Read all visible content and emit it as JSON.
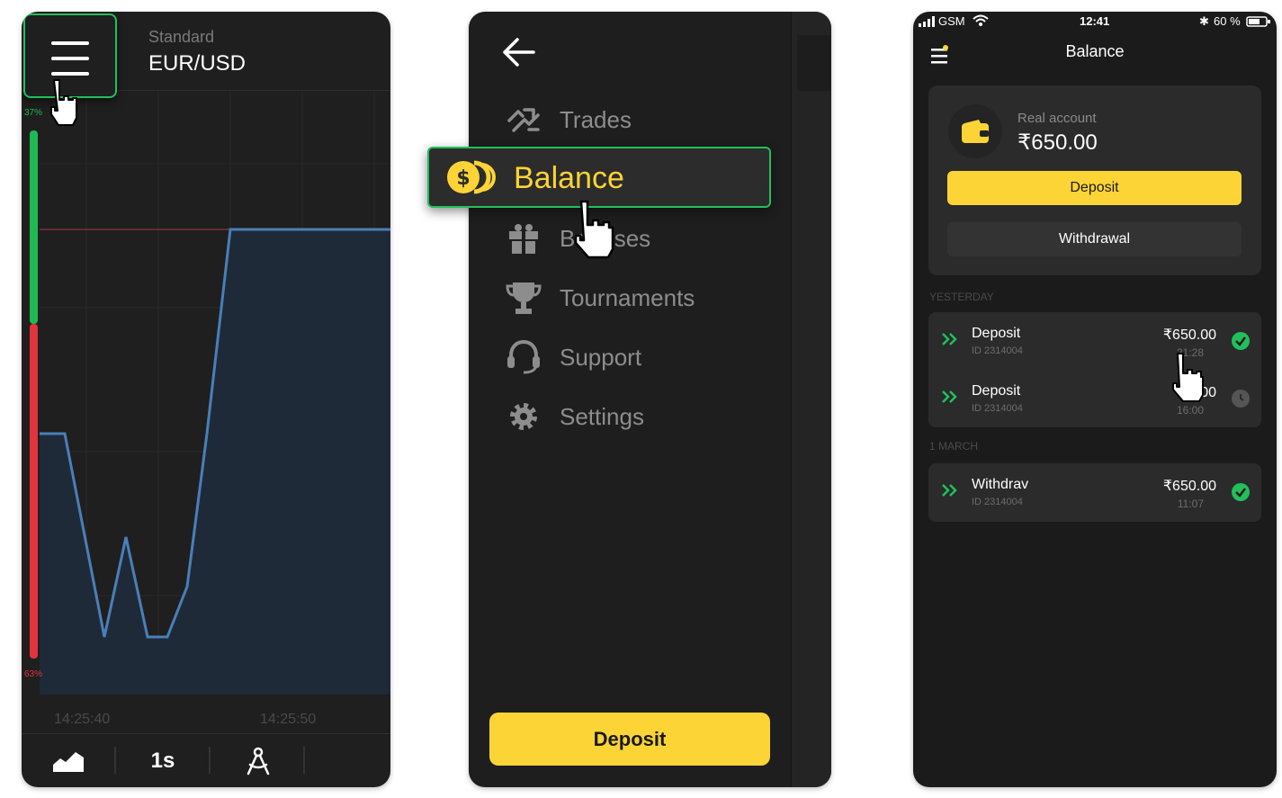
{
  "colors": {
    "accent_yellow": "#fcd436",
    "highlight_green": "#21c05b",
    "up_green": "#1fb954",
    "down_red": "#e1343e",
    "line_blue": "#4a7fb8"
  },
  "chart_screen": {
    "account_mode": "Standard",
    "asset_pair": "EUR/USD",
    "up_percent": "37%",
    "down_percent": "63%",
    "time_labels": [
      "14:25:40",
      "14:25:50"
    ],
    "timeframe": "1s",
    "icons": [
      "menu-icon",
      "area-chart-icon",
      "drawing-tools-icon",
      "hand-cursor-icon"
    ]
  },
  "menu_screen": {
    "back_icon": "arrow-left-icon",
    "items": [
      {
        "label": "Trades",
        "icon": "trades-icon"
      },
      {
        "label": "Bonuses",
        "icon": "gift-icon"
      },
      {
        "label": "Tournaments",
        "icon": "trophy-icon"
      },
      {
        "label": "Support",
        "icon": "headset-icon"
      },
      {
        "label": "Settings",
        "icon": "gear-icon"
      }
    ],
    "highlighted": {
      "label": "Balance",
      "icon": "coins-icon"
    },
    "deposit_label": "Deposit"
  },
  "balance_screen": {
    "status_bar": {
      "carrier": "GSM",
      "time": "12:41",
      "battery": "60 %"
    },
    "title": "Balance",
    "account_type": "Real account",
    "account_amount": "₹650.00",
    "deposit_label": "Deposit",
    "withdraw_label": "Withdrawal",
    "sections": [
      {
        "label": "YESTERDAY",
        "transactions": [
          {
            "title": "Deposit",
            "id": "ID 2314004",
            "amount": "₹650.00",
            "time": "21:28",
            "status": "completed"
          },
          {
            "title": "Deposit",
            "id": "ID 2314004",
            "amount": "₹1 00",
            "time": "16:00",
            "status": "pending"
          }
        ]
      },
      {
        "label": "1 MARCH",
        "transactions": [
          {
            "title": "Withdrav",
            "id": "ID 2314004",
            "amount": "₹650.00",
            "time": "11:07",
            "status": "completed"
          }
        ]
      }
    ]
  }
}
